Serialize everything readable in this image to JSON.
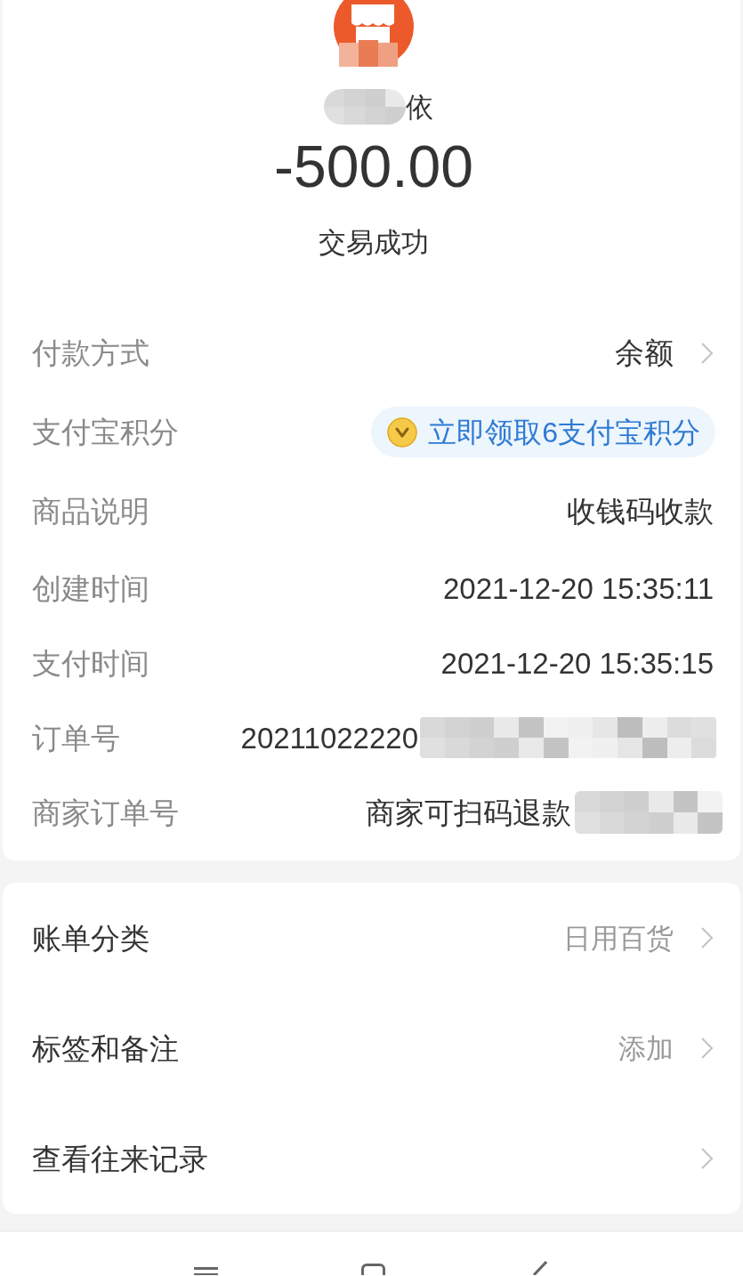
{
  "header": {
    "name_visible": "依",
    "amount": "-500.00",
    "status": "交易成功"
  },
  "details": [
    {
      "kind": "link",
      "label": "付款方式",
      "value": "余额"
    },
    {
      "kind": "points",
      "label": "支付宝积分",
      "value": "立即领取6支付宝积分"
    },
    {
      "kind": "text",
      "label": "商品说明",
      "value": "收钱码收款"
    },
    {
      "kind": "text",
      "label": "创建时间",
      "value": "2021-12-20 15:35:11"
    },
    {
      "kind": "text",
      "label": "支付时间",
      "value": "2021-12-20 15:35:15"
    },
    {
      "kind": "redacted",
      "label": "订单号",
      "value": "20211022220"
    },
    {
      "kind": "redacted",
      "label": "商家订单号",
      "value": "商家可扫码退款"
    }
  ],
  "actions": [
    {
      "label": "账单分类",
      "value": "日用百货"
    },
    {
      "label": "标签和备注",
      "value": "添加"
    },
    {
      "label": "查看往来记录"
    }
  ]
}
